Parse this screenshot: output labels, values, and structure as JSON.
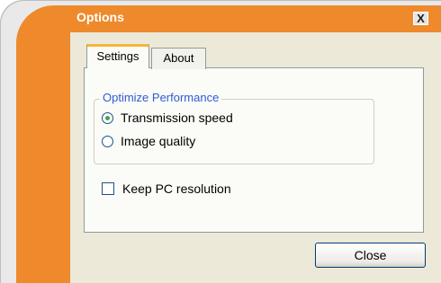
{
  "window": {
    "title": "Options",
    "close_glyph": "X",
    "accent_color": "#ee8a2c"
  },
  "tabs": [
    {
      "label": "Settings",
      "active": true
    },
    {
      "label": "About",
      "active": false
    }
  ],
  "group": {
    "legend": "Optimize Performance",
    "options": [
      {
        "label": "Transmission speed",
        "checked": true
      },
      {
        "label": "Image quality",
        "checked": false
      }
    ]
  },
  "checkbox": {
    "label": "Keep PC resolution",
    "checked": false
  },
  "footer": {
    "close_label": "Close"
  }
}
